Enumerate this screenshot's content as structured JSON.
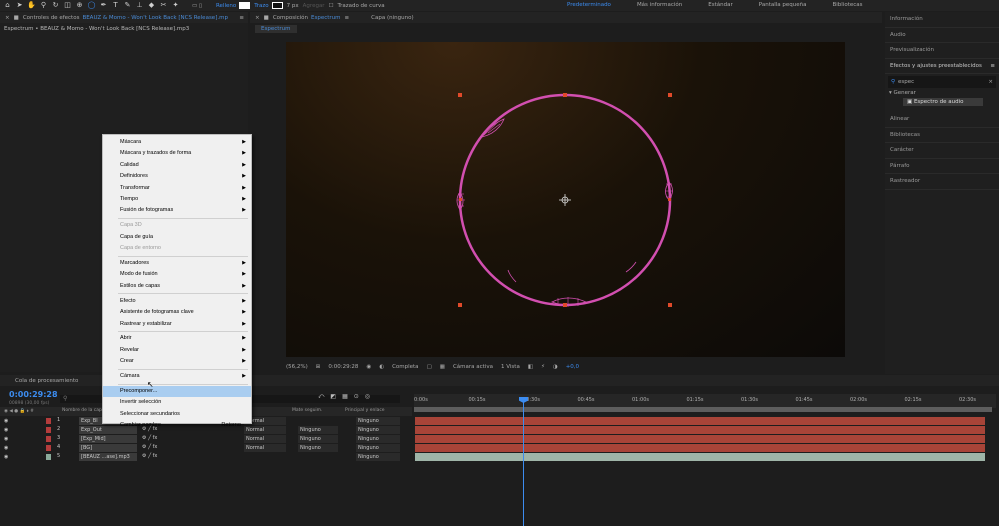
{
  "toolbar": {
    "fill_label": "Relleno",
    "stroke_label": "Trazo",
    "stroke_width": "7 px",
    "add_label": "Agregar",
    "bezier_label": "Trazado de curva",
    "workspaces": [
      "Predeterminado",
      "Más información",
      "Estándar",
      "Pantalla pequeña",
      "Bibliotecas"
    ]
  },
  "effects_panel": {
    "tab_label": "Controles de efectos",
    "tab_file": "BEAUZ & Momo - Won't Look Back [NCS Release].mp",
    "subtitle": "Espectrum • BEAUZ & Momo - Won't Look Back [NCS Release].mp3"
  },
  "comp_panel": {
    "tab_label": "Composición",
    "tab_name": "Espectrum",
    "layer_tab": "Capa (ninguno)",
    "chip": "Espectrum",
    "zoom": "(56,2%)",
    "time": "0:00:29:28",
    "resolution": "Completa",
    "camera": "Cámara activa",
    "views": "1 Vista",
    "offset": "+0,0"
  },
  "right_panel": {
    "items_top": [
      "Información",
      "Audio",
      "Previsualización"
    ],
    "effects_title": "Efectos y ajustes preestablecidos",
    "search_value": "espec",
    "tree_group": "Generar",
    "tree_item": "Espectro de audio",
    "items_bottom": [
      "Alinear",
      "Bibliotecas",
      "Carácter",
      "Párrafo",
      "Rastreador"
    ]
  },
  "context_menu": {
    "items": [
      {
        "label": "Máscara",
        "arrow": true,
        "disabled": false
      },
      {
        "label": "Máscara y trazados de forma",
        "arrow": true,
        "disabled": false
      },
      {
        "label": "Calidad",
        "arrow": true,
        "disabled": false
      },
      {
        "label": "Definidores",
        "arrow": true,
        "disabled": false
      },
      {
        "label": "Transformar",
        "arrow": true,
        "disabled": false
      },
      {
        "label": "Tiempo",
        "arrow": true,
        "disabled": false
      },
      {
        "label": "Fusión de fotogramas",
        "arrow": true,
        "disabled": false
      },
      {
        "label": "Capa 3D",
        "arrow": false,
        "disabled": true
      },
      {
        "label": "Capa de guía",
        "arrow": false,
        "disabled": false
      },
      {
        "label": "Capa de entorno",
        "arrow": false,
        "disabled": true
      },
      {
        "label": "Marcadores",
        "arrow": true,
        "disabled": false
      },
      {
        "label": "Modo de fusión",
        "arrow": true,
        "disabled": false
      },
      {
        "label": "Estilos de capas",
        "arrow": true,
        "disabled": false
      },
      {
        "label": "Efecto",
        "arrow": true,
        "disabled": false
      },
      {
        "label": "Asistente de fotogramas clave",
        "arrow": true,
        "disabled": false
      },
      {
        "label": "Rastrear y estabilizar",
        "arrow": true,
        "disabled": false
      },
      {
        "label": "Abrir",
        "arrow": true,
        "disabled": false
      },
      {
        "label": "Revelar",
        "arrow": true,
        "disabled": false
      },
      {
        "label": "Crear",
        "arrow": true,
        "disabled": false
      },
      {
        "label": "Cámara",
        "arrow": true,
        "disabled": false
      },
      {
        "label": "Precomponer...",
        "arrow": false,
        "disabled": false,
        "highlighted": true
      },
      {
        "label": "Invertir selección",
        "arrow": false,
        "disabled": false
      },
      {
        "label": "Seleccionar secundarios",
        "arrow": false,
        "disabled": false
      },
      {
        "label": "Cambiar nombre",
        "arrow": false,
        "disabled": false,
        "shortcut": "Retorno"
      }
    ]
  },
  "timeline": {
    "tab_queue": "Cola de procesamiento",
    "timecode": "0:00:29:28",
    "timecode_sub": "00898 (30,00 fps)",
    "col_name": "Nombre de la capa",
    "col_track": "Mate seguim.",
    "col_parent": "Principal y enlace",
    "ruler": [
      "0:00s",
      "00:15s",
      "00:30s",
      "00:45s",
      "01:00s",
      "01:15s",
      "01:30s",
      "01:45s",
      "02:00s",
      "02:15s",
      "02:30s"
    ],
    "layers": [
      {
        "num": "1",
        "name": "Exp_Bl",
        "mode": "Normal",
        "track": "",
        "parent": "Ninguno",
        "label_color": "#b43c3c",
        "bar_color": "#a84438"
      },
      {
        "num": "2",
        "name": "Exp_Out",
        "mode": "Normal",
        "track": "Ninguno",
        "parent": "Ninguno",
        "label_color": "#b43c3c",
        "bar_color": "#a84438"
      },
      {
        "num": "3",
        "name": "[Exp_Mid]",
        "mode": "Normal",
        "track": "Ninguno",
        "parent": "Ninguno",
        "label_color": "#b43c3c",
        "bar_color": "#a84438"
      },
      {
        "num": "4",
        "name": "[BG]",
        "mode": "Normal",
        "track": "Ninguno",
        "parent": "Ninguno",
        "label_color": "#b43c3c",
        "bar_color": "#a84438"
      },
      {
        "num": "5",
        "name": "[BEAUZ ...ase].mp3",
        "mode": "",
        "track": "",
        "parent": "Ninguno",
        "label_color": "#8aaa9a",
        "bar_color": "#9fb5a8"
      }
    ]
  },
  "colors": {
    "accent": "#3c8cf0",
    "circle": "#d24fb0",
    "handle": "#e04a2a"
  }
}
